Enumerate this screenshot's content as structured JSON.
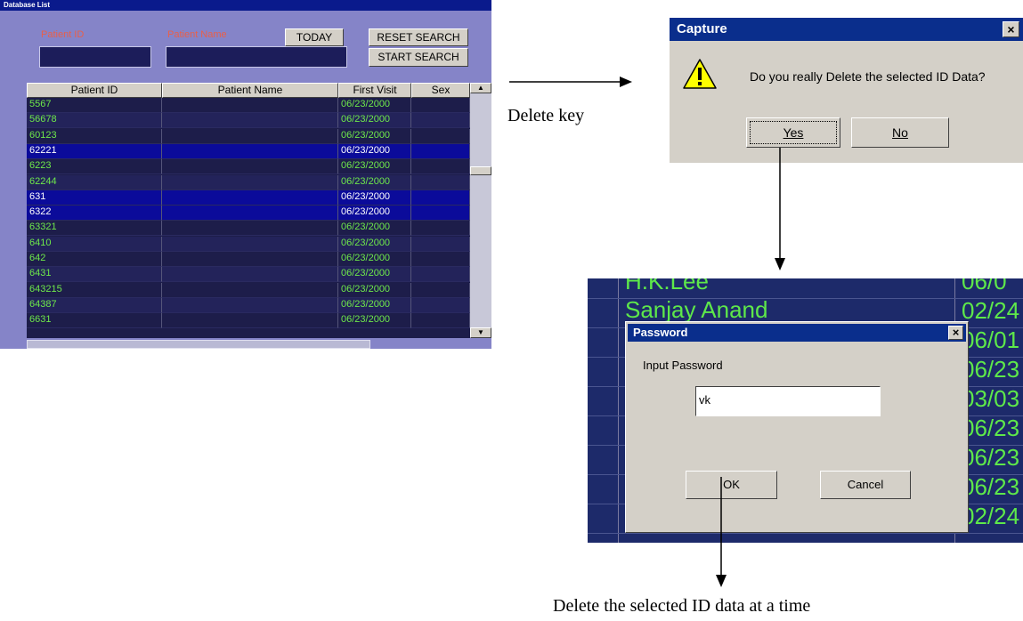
{
  "db_window": {
    "title": "Database List",
    "patient_id_label": "Patient ID",
    "patient_name_label": "Patient Name",
    "today_label": "TODAY",
    "reset_label": "RESET SEARCH",
    "start_label": "START SEARCH",
    "columns": [
      "Patient ID",
      "Patient Name",
      "First Visit",
      "Sex"
    ],
    "rows": [
      {
        "id": "5567",
        "date": "06/23/2000",
        "selected": false
      },
      {
        "id": "56678",
        "date": "06/23/2000",
        "selected": false
      },
      {
        "id": "60123",
        "date": "06/23/2000",
        "selected": false
      },
      {
        "id": "62221",
        "date": "06/23/2000",
        "selected": true
      },
      {
        "id": "6223",
        "date": "06/23/2000",
        "selected": false
      },
      {
        "id": "62244",
        "date": "06/23/2000",
        "selected": false
      },
      {
        "id": "631",
        "date": "06/23/2000",
        "selected": true
      },
      {
        "id": "6322",
        "date": "06/23/2000",
        "selected": true
      },
      {
        "id": "63321",
        "date": "06/23/2000",
        "selected": false
      },
      {
        "id": "6410",
        "date": "06/23/2000",
        "selected": false
      },
      {
        "id": "642",
        "date": "06/23/2000",
        "selected": false
      },
      {
        "id": "6431",
        "date": "06/23/2000",
        "selected": false
      },
      {
        "id": "643215",
        "date": "06/23/2000",
        "selected": false
      },
      {
        "id": "64387",
        "date": "06/23/2000",
        "selected": false
      },
      {
        "id": "6631",
        "date": "06/23/2000",
        "selected": false
      }
    ]
  },
  "annotations": {
    "delete_key": "Delete key",
    "result": "Delete the selected ID data at a time"
  },
  "capture_dialog": {
    "title": "Capture",
    "message": "Do you really Delete the selected ID Data?",
    "yes_label": "Yes",
    "no_label": "No",
    "close_glyph": "×"
  },
  "password_dialog": {
    "title": "Password",
    "prompt": "Input Password",
    "value": "vk",
    "ok_label": "OK",
    "cancel_label": "Cancel",
    "close_glyph": "×",
    "background_names": [
      "H.K.Lee",
      "Sanjay Anand"
    ],
    "background_dates": [
      "06/0",
      "02/24",
      "06/01",
      "06/23",
      "03/03",
      "06/23",
      "06/23",
      "06/23",
      "02/24"
    ]
  },
  "colors": {
    "grid_text": "#6ee84a",
    "selected_row": "#0b0b9a",
    "title_bar": "#0a2e8c"
  }
}
